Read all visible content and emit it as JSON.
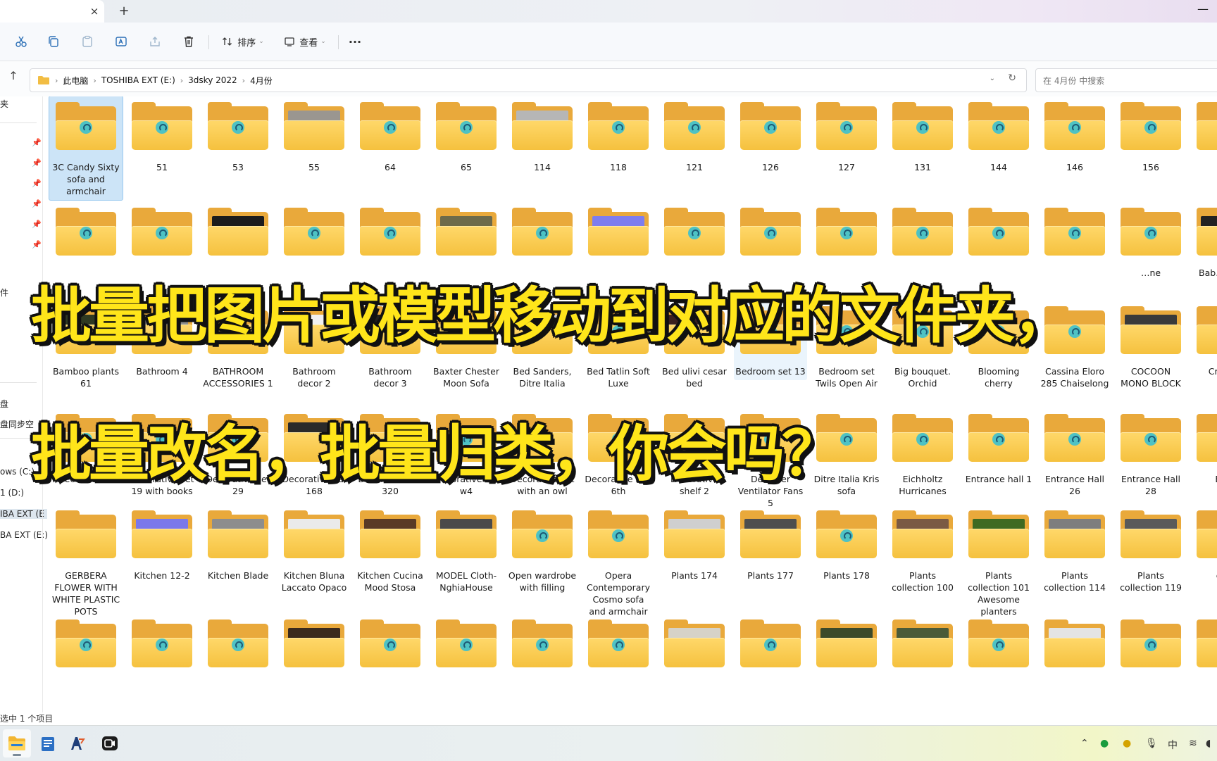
{
  "window": {
    "new_tab_symbol": "+",
    "close_tab_symbol": "×",
    "minimize_symbol": "—"
  },
  "toolbar": {
    "sort_label": "排序",
    "view_label": "查看",
    "more_symbol": "···"
  },
  "address": {
    "crumbs": [
      "此电脑",
      "TOSHIBA EXT (E:)",
      "3dsky 2022",
      "4月份"
    ],
    "search_placeholder": "在 4月份 中搜索"
  },
  "nav": {
    "items": [
      "夹",
      "件",
      "盘",
      "盘同步空",
      "ows (C:)",
      "1 (D:)",
      "IBA EXT (E",
      "BA EXT (E:)"
    ]
  },
  "folders": {
    "row1": [
      {
        "name": "3C Candy Sixty sofa and armchair",
        "thumb": "",
        "selected": true
      },
      {
        "name": "51",
        "thumb": ""
      },
      {
        "name": "53",
        "thumb": ""
      },
      {
        "name": "55",
        "thumb": "#9a9690"
      },
      {
        "name": "64",
        "thumb": ""
      },
      {
        "name": "65",
        "thumb": ""
      },
      {
        "name": "114",
        "thumb": "#b6b6b6"
      },
      {
        "name": "118",
        "thumb": ""
      },
      {
        "name": "121",
        "thumb": ""
      },
      {
        "name": "126",
        "thumb": ""
      },
      {
        "name": "127",
        "thumb": ""
      },
      {
        "name": "131",
        "thumb": ""
      },
      {
        "name": "144",
        "thumb": ""
      },
      {
        "name": "146",
        "thumb": ""
      },
      {
        "name": "156",
        "thumb": ""
      },
      {
        "name": "",
        "thumb": ""
      }
    ],
    "row2": [
      {
        "name": "",
        "thumb": ""
      },
      {
        "name": "",
        "thumb": ""
      },
      {
        "name": "",
        "thumb": "#1c1c1c"
      },
      {
        "name": "",
        "thumb": ""
      },
      {
        "name": "",
        "thumb": ""
      },
      {
        "name": "",
        "thumb": "#6d6a4a"
      },
      {
        "name": "",
        "thumb": ""
      },
      {
        "name": "",
        "thumb": "#7e7dee"
      },
      {
        "name": "",
        "thumb": ""
      },
      {
        "name": "",
        "thumb": ""
      },
      {
        "name": "",
        "thumb": ""
      },
      {
        "name": "",
        "thumb": ""
      },
      {
        "name": "",
        "thumb": ""
      },
      {
        "name": "",
        "thumb": ""
      },
      {
        "name": "…ne",
        "thumb": ""
      },
      {
        "name": "Bab… by P…",
        "thumb": "#222222"
      }
    ],
    "row3": [
      {
        "name": "Bamboo plants 61",
        "thumb": "#2f3a22"
      },
      {
        "name": "Bathroom 4",
        "thumb": "#8e8e8e"
      },
      {
        "name": "BATHROOM ACCESSORIES 1",
        "thumb": ""
      },
      {
        "name": "Bathroom decor 2",
        "thumb": "#f1f1f1"
      },
      {
        "name": "Bathroom decor 3",
        "thumb": "#1f1f1f"
      },
      {
        "name": "Baxter Chester Moon Sofa",
        "thumb": ""
      },
      {
        "name": "Bed Sanders, Ditre Italia",
        "thumb": "#cfcfcf"
      },
      {
        "name": "Bed Tatlin Soft Luxe",
        "thumb": ""
      },
      {
        "name": "Bed ulivi cesar bed",
        "thumb": "#3a2020"
      },
      {
        "name": "Bedroom set 13",
        "thumb": "",
        "hover": true
      },
      {
        "name": "Bedroom set Twils Open Air",
        "thumb": ""
      },
      {
        "name": "Big bouquet. Orchid",
        "thumb": ""
      },
      {
        "name": "Blooming cherry",
        "thumb": ""
      },
      {
        "name": "Cassina Eloro 285 Chaiselong",
        "thumb": ""
      },
      {
        "name": "COCOON MONO BLOCK",
        "thumb": "#3a3a3a"
      },
      {
        "name": "Cr… D…",
        "thumb": ""
      }
    ],
    "row4": [
      {
        "name": "Decor set 80",
        "thumb": ""
      },
      {
        "name": "Decorative set 19 with books",
        "thumb": ""
      },
      {
        "name": "Decorative set 29",
        "thumb": ""
      },
      {
        "name": "Decorative set 168",
        "thumb": "#2a2a2a"
      },
      {
        "name": "Decorative set 320",
        "thumb": ""
      },
      {
        "name": "Decorative set w4",
        "thumb": ""
      },
      {
        "name": "Decorative set with an owl",
        "thumb": ""
      },
      {
        "name": "Decorative set. 6th",
        "thumb": ""
      },
      {
        "name": "Decorative shelf 2",
        "thumb": ""
      },
      {
        "name": "Designer Ventilator Fans 5",
        "thumb": ""
      },
      {
        "name": "Ditre Italia Kris sofa",
        "thumb": ""
      },
      {
        "name": "Eichholtz Hurricanes",
        "thumb": ""
      },
      {
        "name": "Entrance hall 1",
        "thumb": ""
      },
      {
        "name": "Entrance Hall 26",
        "thumb": ""
      },
      {
        "name": "Entrance Hall 28",
        "thumb": ""
      },
      {
        "name": "Ent…",
        "thumb": ""
      }
    ],
    "row5": [
      {
        "name": "GERBERA FLOWER WITH WHITE PLASTIC POTS",
        "thumb": "none"
      },
      {
        "name": "Kitchen 12-2",
        "thumb": "#7b78ea"
      },
      {
        "name": "Kitchen Blade",
        "thumb": "#8d8d8d"
      },
      {
        "name": "Kitchen Bluna Laccato Opaco",
        "thumb": "#eaeaea"
      },
      {
        "name": "Kitchen Cucina Mood Stosa",
        "thumb": "#5a3a26"
      },
      {
        "name": "MODEL Cloth-NghiaHouse",
        "thumb": "#4a4a4a"
      },
      {
        "name": "Open wardrobe with filling",
        "thumb": ""
      },
      {
        "name": "Opera Contemporary Cosmo sofa and armchair",
        "thumb": ""
      },
      {
        "name": "Plants 174",
        "thumb": "#cfcfcf"
      },
      {
        "name": "Plants 177",
        "thumb": "#4e4e4e"
      },
      {
        "name": "Plants 178",
        "thumb": ""
      },
      {
        "name": "Plants collection 100",
        "thumb": "#7a5a44"
      },
      {
        "name": "Plants collection 101 Awesome planters",
        "thumb": "#3f6a22"
      },
      {
        "name": "Plants collection 114",
        "thumb": "#7e7e7e"
      },
      {
        "name": "Plants collection 119",
        "thumb": "#5a5a5a"
      },
      {
        "name": "col…",
        "thumb": ""
      }
    ],
    "row6": [
      {
        "name": "",
        "thumb": ""
      },
      {
        "name": "",
        "thumb": ""
      },
      {
        "name": "",
        "thumb": ""
      },
      {
        "name": "",
        "thumb": "#3b2a1d"
      },
      {
        "name": "",
        "thumb": ""
      },
      {
        "name": "",
        "thumb": ""
      },
      {
        "name": "",
        "thumb": ""
      },
      {
        "name": "",
        "thumb": ""
      },
      {
        "name": "",
        "thumb": "#d6d2c8"
      },
      {
        "name": "",
        "thumb": ""
      },
      {
        "name": "",
        "thumb": "#3c4a2a"
      },
      {
        "name": "",
        "thumb": "#4a5a38"
      },
      {
        "name": "",
        "thumb": ""
      },
      {
        "name": "",
        "thumb": "#e4e4e4"
      },
      {
        "name": "",
        "thumb": ""
      },
      {
        "name": "",
        "thumb": ""
      }
    ]
  },
  "status": {
    "selection": "选中 1 个项目"
  },
  "tray": {
    "ime": "中"
  },
  "overlay": {
    "line1": "批量把图片或模型移动到对应的文件夹，",
    "line2": "批量改名，批量归类，你会吗？"
  },
  "colors": {
    "folder_front": "#f5c13e",
    "folder_back": "#e9a93b",
    "overlay_text": "#ffe51a",
    "selection": "#cce4f7"
  }
}
